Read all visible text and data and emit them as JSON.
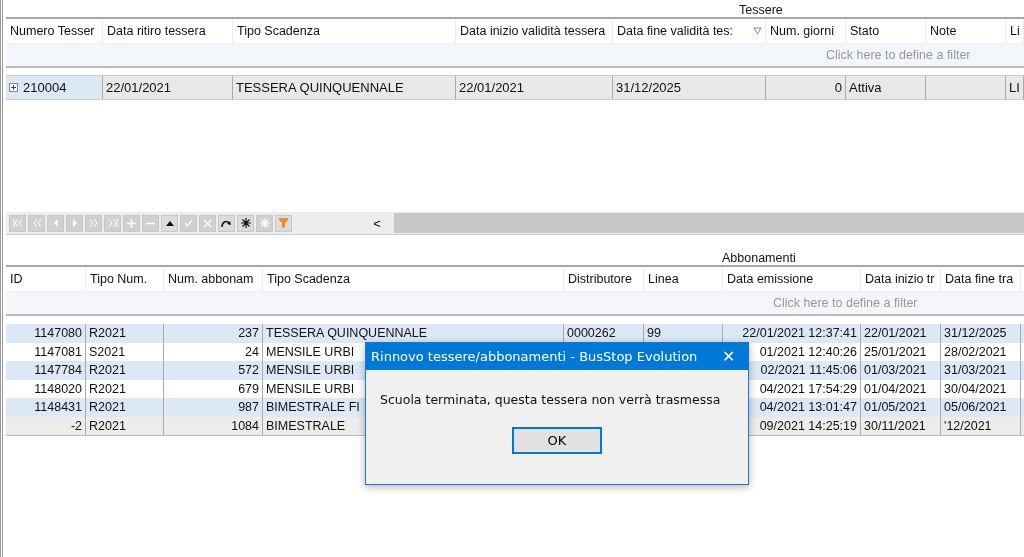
{
  "tessere": {
    "caption": "Tessere",
    "columns": [
      {
        "label": "Numero Tesser",
        "sorted": false
      },
      {
        "label": "Data ritiro tessera",
        "sorted": false
      },
      {
        "label": "Tipo Scadenza",
        "sorted": false
      },
      {
        "label": "Data inizio validità tessera",
        "sorted": false
      },
      {
        "label": "Data fine validità tes:",
        "sorted": true
      },
      {
        "label": "Num. giorni",
        "sorted": false
      },
      {
        "label": "Stato",
        "sorted": false
      },
      {
        "label": "Note",
        "sorted": false
      },
      {
        "label": "Li",
        "sorted": false
      }
    ],
    "filter_hint": "Click here to define a filter",
    "rows": [
      {
        "expandable": true,
        "selected": true,
        "cells": [
          "210004",
          "22/01/2021",
          "TESSERA QUINQUENNALE",
          "22/01/2021",
          "31/12/2025",
          "0",
          "Attiva",
          "",
          "LI"
        ]
      }
    ]
  },
  "navigator": [
    {
      "kind": "first",
      "disabled": true
    },
    {
      "kind": "prev-page",
      "disabled": true
    },
    {
      "kind": "prev",
      "disabled": true
    },
    {
      "kind": "next",
      "disabled": true
    },
    {
      "kind": "next-page",
      "disabled": true
    },
    {
      "kind": "last",
      "disabled": true
    },
    {
      "kind": "add",
      "disabled": true
    },
    {
      "kind": "remove",
      "disabled": true
    },
    {
      "kind": "up",
      "disabled": false
    },
    {
      "kind": "check",
      "disabled": true
    },
    {
      "kind": "cancel",
      "disabled": true
    },
    {
      "kind": "refresh",
      "disabled": false
    },
    {
      "kind": "star",
      "disabled": false
    },
    {
      "kind": "star",
      "disabled": true
    },
    {
      "kind": "filter",
      "disabled": false
    }
  ],
  "navigator_scroll": "<",
  "abbonamenti": {
    "caption": "Abbonamenti",
    "columns": [
      "ID",
      "Tipo Num.",
      "Num. abbonam",
      "Tipo Scadenza",
      "Distributore",
      "Linea",
      "Data emissione",
      "Data inizio tr",
      "Data fine tra"
    ],
    "filter_hint": "Click here to define a filter",
    "rows": [
      {
        "selected": false,
        "cells": [
          "1147080",
          "R2021",
          "237",
          "TESSERA QUINQUENNALE",
          "0000262",
          "99",
          "22/01/2021 12:37:41",
          "22/01/2021",
          "31/12/2025"
        ]
      },
      {
        "selected": false,
        "cells": [
          "1147081",
          "S2021",
          "24",
          "MENSILE URBI",
          "",
          "",
          "01/2021 12:40:26",
          "25/01/2021",
          "28/02/2021"
        ]
      },
      {
        "selected": false,
        "cells": [
          "1147784",
          "R2021",
          "572",
          "MENSILE URBI",
          "",
          "",
          "02/2021 11:45:06",
          "01/03/2021",
          "31/03/2021"
        ]
      },
      {
        "selected": false,
        "cells": [
          "1148020",
          "R2021",
          "679",
          "MENSILE URBI",
          "",
          "",
          "04/2021 17:54:29",
          "01/04/2021",
          "30/04/2021"
        ]
      },
      {
        "selected": false,
        "cells": [
          "1148431",
          "R2021",
          "987",
          "BIMESTRALE FI",
          "",
          "",
          "04/2021 13:01:47",
          "01/05/2021",
          "05/06/2021"
        ]
      },
      {
        "selected": true,
        "cells": [
          "-2",
          "R2021",
          "1084",
          "BIMESTRALE",
          "",
          "",
          "09/2021 14:25:19",
          "30/11/2021",
          "'12/2021"
        ]
      }
    ]
  },
  "dialog": {
    "title": "Rinnovo tessere/abbonamenti - BusStop Evolution",
    "close": "✕",
    "message": "Scuola terminata, questa tessera non verrà trasmessa",
    "button": "OK"
  }
}
